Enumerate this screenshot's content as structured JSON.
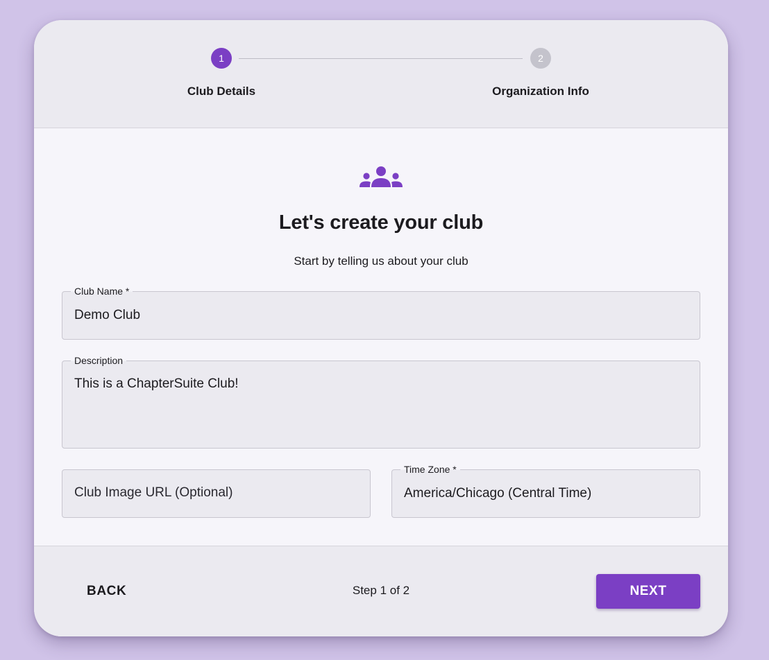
{
  "stepper": {
    "steps": [
      {
        "number": "1",
        "label": "Club Details",
        "state": "active"
      },
      {
        "number": "2",
        "label": "Organization Info",
        "state": "inactive"
      }
    ]
  },
  "hero": {
    "icon": "groups-icon",
    "title": "Let's create your club",
    "subtitle": "Start by telling us about your club"
  },
  "form": {
    "club_name": {
      "label": "Club Name *",
      "value": "Demo Club"
    },
    "description": {
      "label": "Description",
      "value": "This is a ChapterSuite Club!"
    },
    "club_image_url": {
      "label": "",
      "placeholder": "Club Image URL (Optional)",
      "value": ""
    },
    "time_zone": {
      "label": "Time Zone *",
      "value": "America/Chicago (Central Time)"
    }
  },
  "footer": {
    "back_label": "BACK",
    "step_counter": "Step 1 of 2",
    "next_label": "NEXT"
  },
  "colors": {
    "page_background": "#d0c3e8",
    "accent": "#7b3fc4",
    "inactive_step": "#c4c3cc",
    "surface": "#f6f5fa",
    "header_footer": "#ebeaf0"
  }
}
